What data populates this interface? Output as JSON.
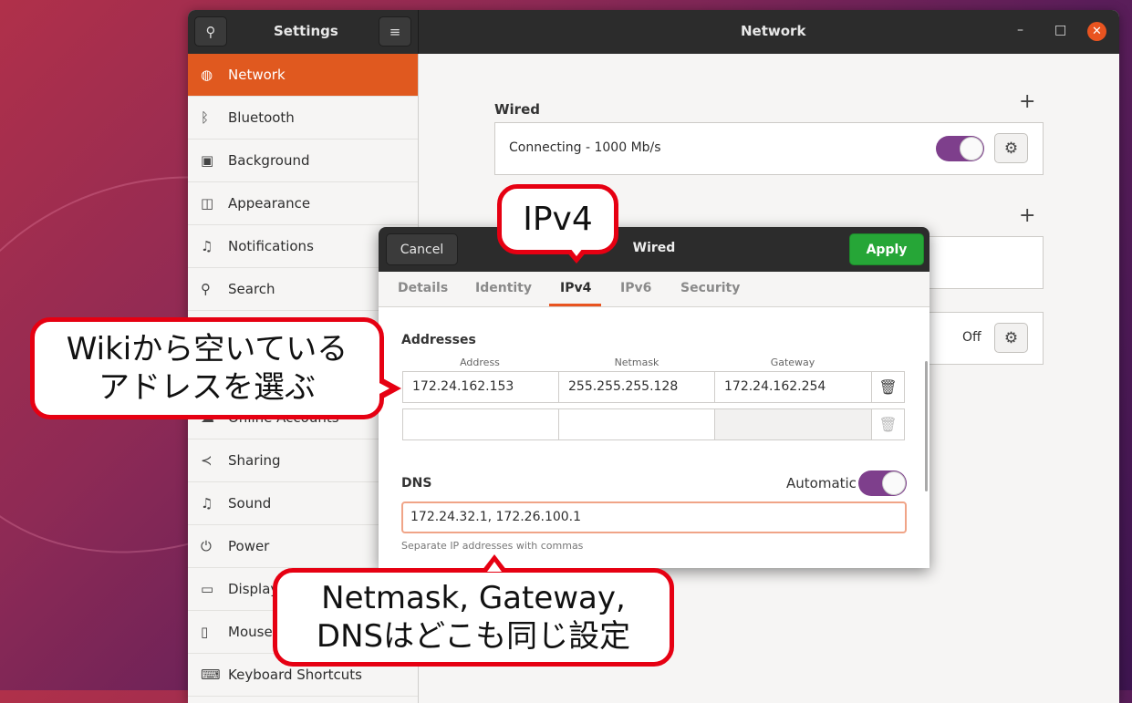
{
  "window": {
    "sidebar_title": "Settings",
    "main_title": "Network",
    "controls": {
      "minimize": "–",
      "maximize": "□",
      "close": "✕"
    }
  },
  "sidebar": {
    "items": [
      {
        "label": "Network",
        "icon": "globe-icon",
        "glyph": "◍",
        "active": true
      },
      {
        "label": "Bluetooth",
        "icon": "bluetooth-icon",
        "glyph": "ᛒ"
      },
      {
        "label": "Background",
        "icon": "monitor-icon",
        "glyph": "▣"
      },
      {
        "label": "Appearance",
        "icon": "appearance-icon",
        "glyph": "◫"
      },
      {
        "label": "Notifications",
        "icon": "bell-icon",
        "glyph": "♫"
      },
      {
        "label": "Search",
        "icon": "search-icon",
        "glyph": "⚲"
      },
      {
        "label": "",
        "icon": "",
        "glyph": ""
      },
      {
        "label": "",
        "icon": "",
        "glyph": ""
      },
      {
        "label": "Online Accounts",
        "icon": "cloud-icon",
        "glyph": "☁"
      },
      {
        "label": "Sharing",
        "icon": "share-icon",
        "glyph": "≺"
      },
      {
        "label": "Sound",
        "icon": "music-icon",
        "glyph": "♫"
      },
      {
        "label": "Power",
        "icon": "power-icon",
        "glyph": "⏻"
      },
      {
        "label": "Displays",
        "icon": "display-icon",
        "glyph": "▭"
      },
      {
        "label": "Mouse & Touchpad",
        "icon": "mouse-icon",
        "glyph": "▯"
      },
      {
        "label": "Keyboard Shortcuts",
        "icon": "keyboard-icon",
        "glyph": "⌨"
      }
    ]
  },
  "main": {
    "wired_title": "Wired",
    "wired_status": "Connecting - 1000 Mb/s",
    "vpn_status": "Off"
  },
  "dialog": {
    "cancel_label": "Cancel",
    "title": "Wired",
    "apply_label": "Apply",
    "tabs": [
      "Details",
      "Identity",
      "IPv4",
      "IPv6",
      "Security"
    ],
    "addresses_title": "Addresses",
    "columns": [
      "Address",
      "Netmask",
      "Gateway"
    ],
    "row1": {
      "address": "172.24.162.153",
      "netmask": "255.255.255.128",
      "gateway": "172.24.162.254"
    },
    "dns_title": "DNS",
    "dns_auto_label": "Automatic",
    "dns_value": "172.24.32.1, 172.26.100.1",
    "dns_hint": "Separate IP addresses with commas"
  },
  "callouts": {
    "ipv4": "IPv4",
    "wiki_line1": "Wikiから空いている",
    "wiki_line2": "アドレスを選ぶ",
    "netmask_line1": "Netmask, Gateway,",
    "netmask_line2": "DNSはどこも同じ設定"
  },
  "colors": {
    "accent": "#e95420",
    "apply": "#26a637",
    "toggle": "#7e3f8c",
    "callout_border": "#e60012"
  }
}
